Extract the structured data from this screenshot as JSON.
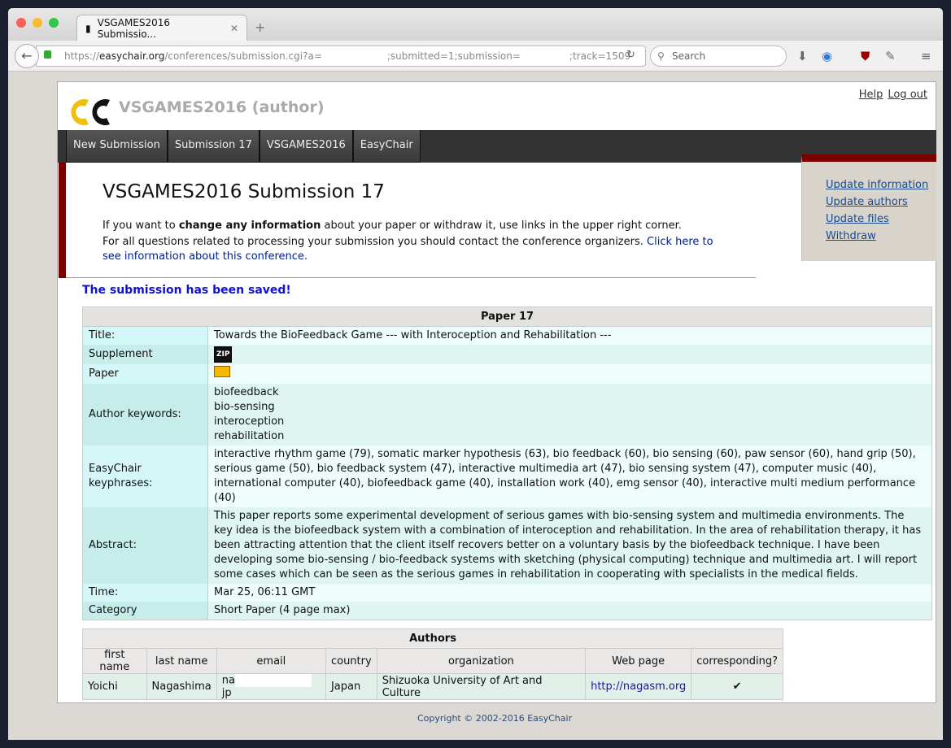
{
  "browser": {
    "tab_title": "VSGAMES2016 Submissio...",
    "url_prefix": "https://",
    "url_domain": "easychair.org",
    "url_path": "/conferences/submission.cgi?a=",
    "url_part2": ";submitted=1;submission=",
    "url_part3": ";track=1509",
    "search_placeholder": "Search"
  },
  "header": {
    "conference": "VSGAMES2016 (author)",
    "help": "Help",
    "logout": "Log out"
  },
  "menu": [
    "New Submission",
    "Submission 17",
    "VSGAMES2016",
    "EasyChair"
  ],
  "sidebar": [
    "Update information",
    "Update authors",
    "Update files",
    "Withdraw"
  ],
  "main": {
    "title": "VSGAMES2016 Submission 17",
    "intro1_a": "If you want to ",
    "intro1_b": "change any information",
    "intro1_c": " about your paper or withdraw it, use links in the upper right corner.",
    "intro2": "For all questions related to processing your submission you should contact the conference organizers. ",
    "intro2_link": "Click here to see information about this conference.",
    "saved": "The submission has been saved!"
  },
  "paper": {
    "header": "Paper 17",
    "title_label": "Title:",
    "title": "Towards the BioFeedback Game --- with Interoception and Rehabilitation ---",
    "supplement_label": "Supplement",
    "paper_label": "Paper",
    "keywords_label": "Author keywords:",
    "keywords": [
      "biofeedback",
      "bio-sensing",
      "interoception",
      "rehabilitation"
    ],
    "keyphrases_label": "EasyChair keyphrases:",
    "keyphrases": "interactive rhythm game (79), somatic marker hypothesis (63), bio feedback (60), bio sensing (60), paw sensor (60), hand grip (50), serious game (50), bio feedback system (47), interactive multimedia art (47), bio sensing system (47), computer music (40), international computer (40), biofeedback game (40), installation work (40), emg sensor (40), interactive multi medium performance (40)",
    "abstract_label": "Abstract:",
    "abstract": "This paper reports some experimental development of serious games with bio-sensing system and multimedia environments. The key idea is the biofeedback system with a combination of interoception and rehabilitation. In the area of rehabilitation therapy, it has been attracting attention that the client itself recovers better on a voluntary basis by the biofeedback technique. I have been developing some bio-sensing / bio-feedback systems with sketching (physical computing) technique and multimedia art. I will report some cases which can be seen as the serious games in rehabilitation in cooperating with specialists in the medical fields.",
    "time_label": "Time:",
    "time": "Mar 25, 06:11 GMT",
    "category_label": "Category",
    "category": "Short Paper (4 page max)"
  },
  "authors": {
    "caption": "Authors",
    "columns": [
      "first name",
      "last name",
      "email",
      "country",
      "organization",
      "Web page",
      "corresponding?"
    ],
    "row": {
      "first": "Yoichi",
      "last": "Nagashima",
      "email_start": "na",
      "email_end": "jp",
      "country": "Japan",
      "org": "Shizuoka University of Art and Culture",
      "web": "http://nagasm.org",
      "corresponding": "✔"
    }
  },
  "footer": "Copyright © 2002-2016 EasyChair"
}
